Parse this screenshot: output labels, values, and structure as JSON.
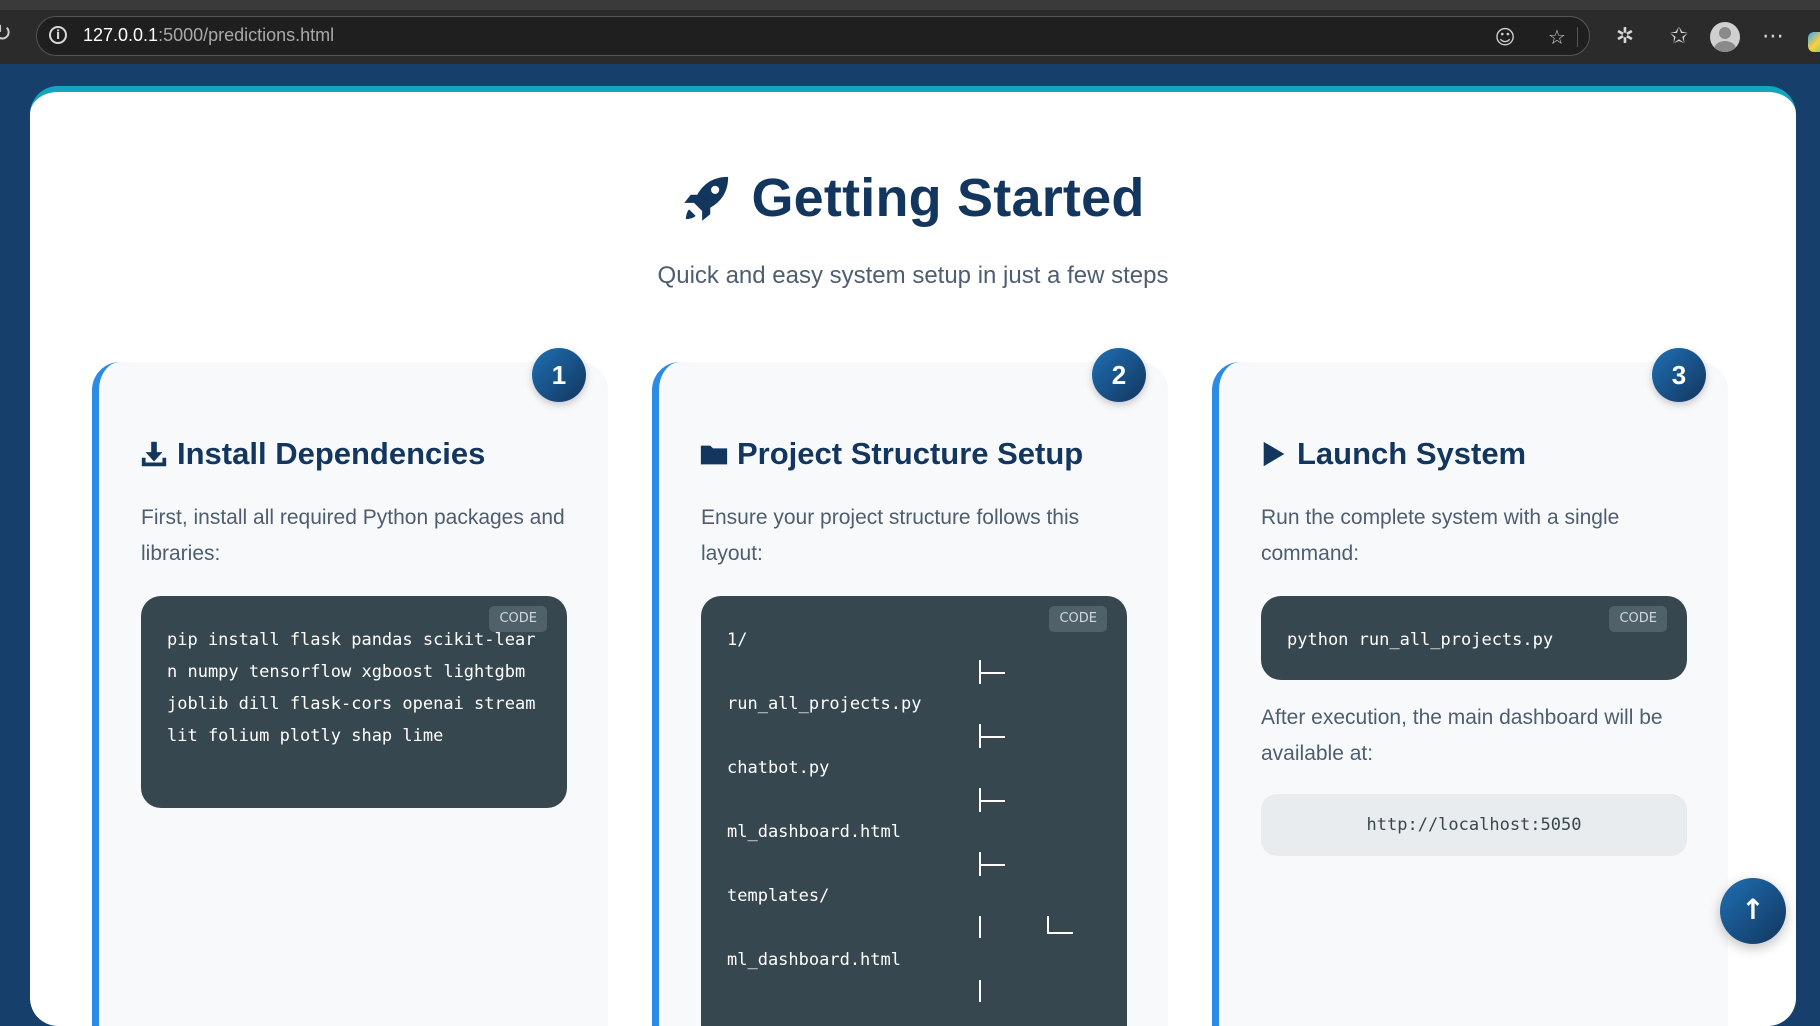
{
  "browser": {
    "url_host": "127.0.0.1",
    "url_path": ":5000/predictions.html"
  },
  "page": {
    "title": "Getting Started",
    "subtitle": "Quick and easy system setup in just a few steps"
  },
  "steps": [
    {
      "number": "1",
      "icon": "download-icon",
      "title": "Install Dependencies",
      "description": "First, install all required Python packages and libraries:",
      "code_tag": "CODE",
      "code": "pip install flask pandas scikit-learn numpy tensorflow xgboost lightgbm joblib dill flask-cors openai streamlit folium plotly shap lime"
    },
    {
      "number": "2",
      "icon": "folder-icon",
      "title": "Project Structure Setup",
      "description": "Ensure your project structure follows this layout:",
      "code_tag": "CODE",
      "tree": [
        "1/",
        "run_all_projects.py",
        "chatbot.py",
        "ml_dashboard.html",
        "templates/",
        "ml_dashboard.html"
      ]
    },
    {
      "number": "3",
      "icon": "play-icon",
      "title": "Launch System",
      "description": "Run the complete system with a single command:",
      "code_tag": "CODE",
      "code": "python run_all_projects.py",
      "after_text": "After execution, the main dashboard will be available at:",
      "url": "http://localhost:5050"
    }
  ],
  "scroll_top_icon": "arrow-up-icon"
}
